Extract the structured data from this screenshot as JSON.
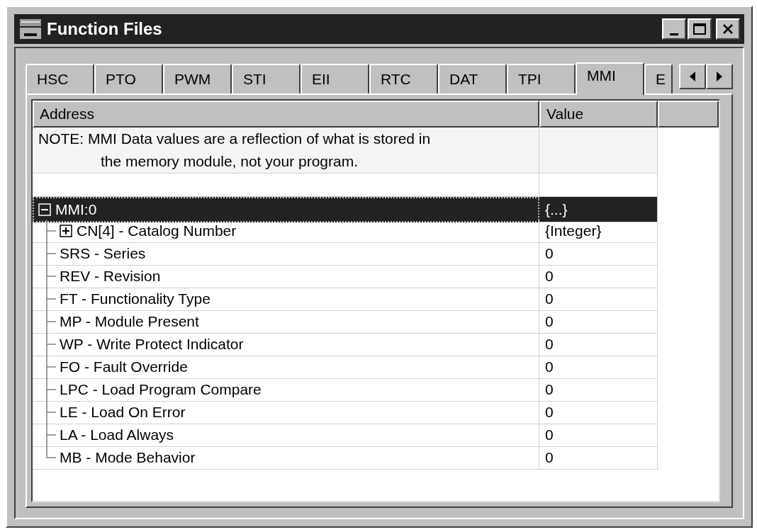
{
  "window": {
    "title": "Function Files"
  },
  "tabs": [
    {
      "label": "HSC",
      "selected": false
    },
    {
      "label": "PTO",
      "selected": false
    },
    {
      "label": "PWM",
      "selected": false
    },
    {
      "label": "STI",
      "selected": false
    },
    {
      "label": "EII",
      "selected": false
    },
    {
      "label": "RTC",
      "selected": false
    },
    {
      "label": "DAT",
      "selected": false
    },
    {
      "label": "TPI",
      "selected": false
    },
    {
      "label": "MMI",
      "selected": true
    },
    {
      "label": "E",
      "selected": false
    }
  ],
  "table": {
    "columns": [
      "Address",
      "Value"
    ],
    "notes": [
      "NOTE: MMI Data values are a reflection of what is stored in",
      "the memory module, not your program."
    ],
    "tree": [
      {
        "address": "MMI:0",
        "value": "{...}",
        "expanded": true,
        "selected": true,
        "children": [
          {
            "kind": "group",
            "address": "CN[4] - Catalog Number",
            "value": "{Integer}",
            "expanded": false
          },
          {
            "kind": "field",
            "address": "SRS - Series",
            "value": "0"
          },
          {
            "kind": "field",
            "address": "REV - Revision",
            "value": "0"
          },
          {
            "kind": "field",
            "address": "FT - Functionality Type",
            "value": "0"
          },
          {
            "kind": "field",
            "address": "MP - Module Present",
            "value": "0"
          },
          {
            "kind": "field",
            "address": "WP - Write Protect Indicator",
            "value": "0"
          },
          {
            "kind": "field",
            "address": "FO - Fault Override",
            "value": "0"
          },
          {
            "kind": "field",
            "address": "LPC - Load Program Compare",
            "value": "0"
          },
          {
            "kind": "field",
            "address": "LE - Load On Error",
            "value": "0"
          },
          {
            "kind": "field",
            "address": "LA - Load Always",
            "value": "0"
          },
          {
            "kind": "field",
            "address": "MB - Mode Behavior",
            "value": "0"
          }
        ]
      }
    ]
  }
}
